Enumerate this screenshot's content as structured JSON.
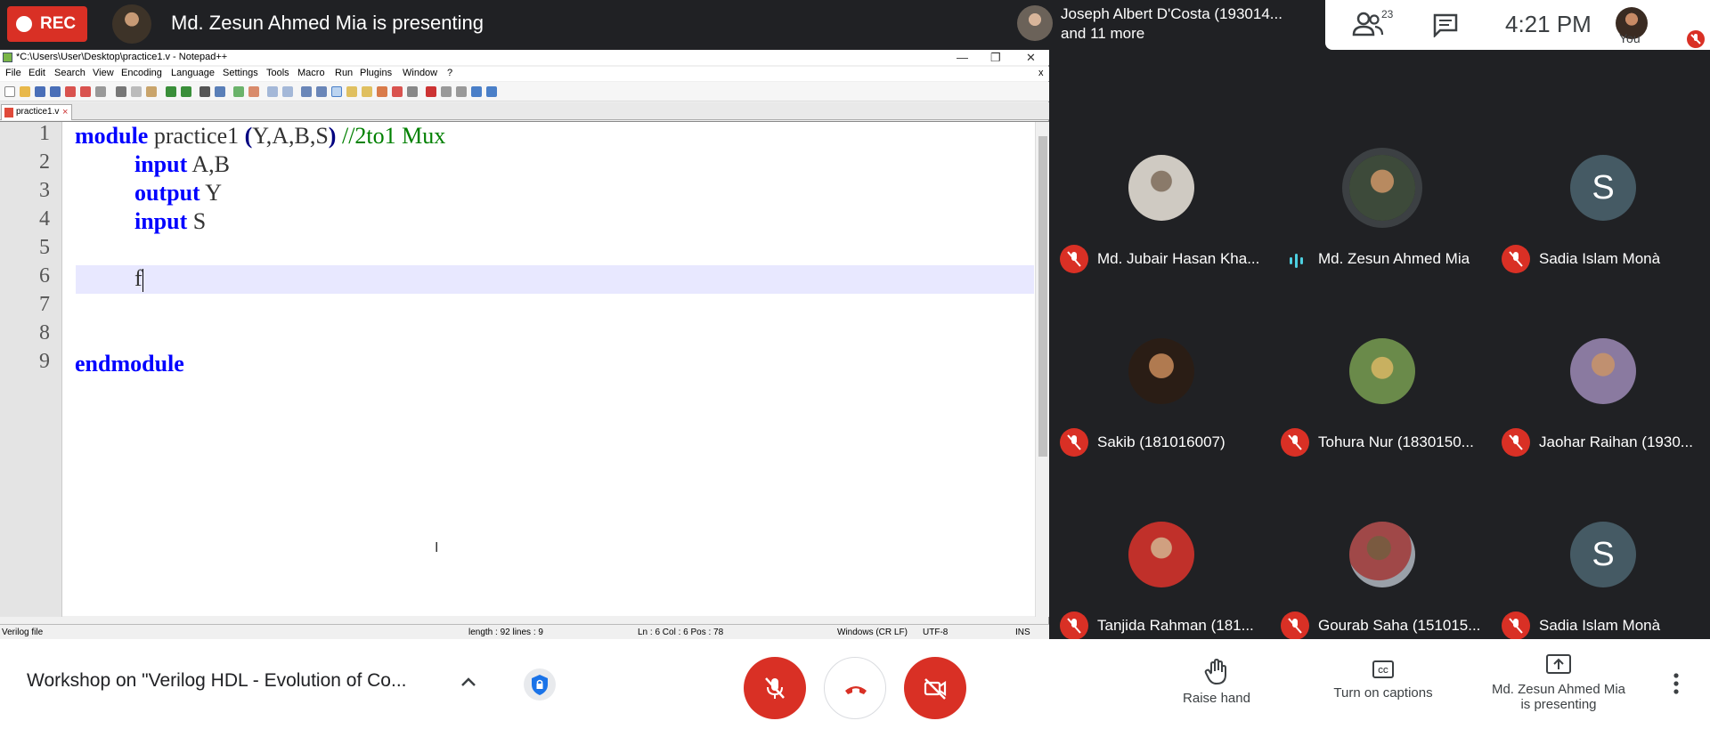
{
  "meet": {
    "rec_label": "REC",
    "presenting_title": "Md. Zesun Ahmed Mia is presenting",
    "joiner_line1": "Joseph Albert D'Costa (193014...",
    "joiner_line2": "and 11 more",
    "people_count": "23",
    "clock": "4:21 PM",
    "you_label": "You",
    "meeting_title": "Workshop on \"Verilog HDL - Evolution of Co...",
    "raise_hand": "Raise hand",
    "captions": "Turn on captions",
    "presenting_line1": "Md. Zesun Ahmed Mia",
    "presenting_line2": "is presenting",
    "colors": {
      "red": "#d93025",
      "dark": "#202124",
      "tile_bg": "#455a64"
    }
  },
  "npp": {
    "title": "*C:\\Users\\User\\Desktop\\practice1.v - Notepad++",
    "menu": [
      "File",
      "Edit",
      "Search",
      "View",
      "Encoding",
      "Language",
      "Settings",
      "Tools",
      "Macro",
      "Run",
      "Plugins",
      "Window",
      "?"
    ],
    "tab": "practice1.v",
    "line_numbers": [
      "1",
      "2",
      "3",
      "4",
      "5",
      "6",
      "7",
      "8",
      "9"
    ],
    "code": {
      "l1_kw": "module",
      "l1_id": " practice1 ",
      "l1_op1": "(",
      "l1_args": "Y,A,B,S",
      "l1_op2": ")",
      "l1_cm": " //2to1 Mux",
      "l2_kw": "input",
      "l2_id": " A,B",
      "l3_kw": "output",
      "l3_id": " Y",
      "l4_kw": "input",
      "l4_id": " S",
      "l6_id": "f",
      "l9_kw": "endmodule"
    },
    "status": {
      "filetype": "Verilog file",
      "length": "length : 92    lines : 9",
      "position": "Ln : 6    Col : 6    Pos : 78",
      "eol": "Windows (CR LF)",
      "encoding": "UTF-8",
      "mode": "INS"
    }
  },
  "participants": [
    {
      "name": "Md. Jubair Hasan Kha...",
      "avatar": "photo"
    },
    {
      "name": "Md. Zesun Ahmed Mia",
      "avatar": "photo"
    },
    {
      "name": "Sadia Islam Monà",
      "avatar": "S"
    },
    {
      "name": "Sakib (181016007)",
      "avatar": "photo"
    },
    {
      "name": "Tohura Nur (1830150...",
      "avatar": "photo"
    },
    {
      "name": "Jaohar Raihan (1930...",
      "avatar": "photo"
    },
    {
      "name": "Tanjida Rahman (181...",
      "avatar": "photo"
    },
    {
      "name": "Gourab Saha (151015...",
      "avatar": "photo"
    },
    {
      "name": "Sadia Islam Monà",
      "avatar": "S"
    }
  ]
}
